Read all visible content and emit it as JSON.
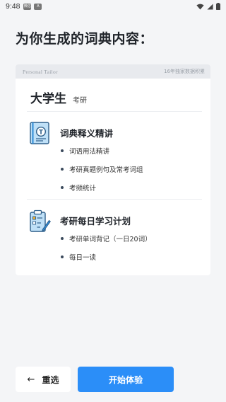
{
  "status_bar": {
    "time": "9:48",
    "notification_badges": [
      "微信",
      "A"
    ]
  },
  "page_title": "为你生成的词典内容：",
  "card": {
    "header_left": "Personal Tailor",
    "header_right": "16年独家数据积累",
    "word": "大学生",
    "tag": "考研",
    "sections": [
      {
        "title": "词典释义精讲",
        "icon": "dictionary-book-icon",
        "items": [
          "词语用法精讲",
          "考研真题例句及常考词组",
          "考频统计"
        ]
      },
      {
        "title": "考研每日学习计划",
        "icon": "study-plan-checklist-icon",
        "items": [
          "考研单词背记（一日20词）",
          "每日一读"
        ]
      }
    ]
  },
  "buttons": {
    "reselect_label": "重选",
    "reselect_icon": "arrow-left-icon",
    "start_label": "开始体验"
  },
  "colors": {
    "primary": "#2b8ef8",
    "background": "#f4f5f7",
    "card_header": "#e8eaee",
    "icon_blue": "#2f8bd6",
    "icon_light": "#bfe0f7"
  }
}
